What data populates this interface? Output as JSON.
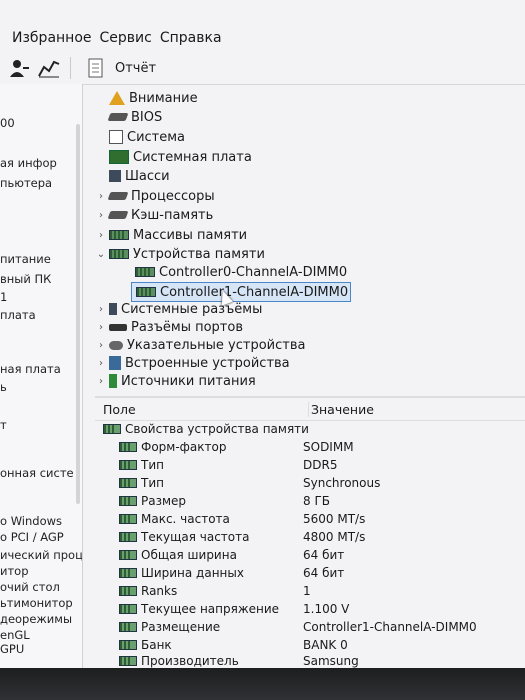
{
  "menu": [
    "Избранное",
    "Сервис",
    "Справка"
  ],
  "toolbar": {
    "report_label": "Отчёт"
  },
  "left_panel": [
    "00",
    "ая инфор",
    "пьютера",
    "питание",
    "вный ПК",
    "1",
    "плата",
    "ная плата",
    "ь",
    "т",
    "онная систе",
    "о Windows",
    "о PCI / AGP",
    "ический проц",
    "итор",
    "очий стол",
    "ьтимонитор",
    "деорежимы",
    "enGL",
    "GPU"
  ],
  "tree": [
    {
      "label": "Внимание",
      "icon": "warning-icon",
      "expand": ""
    },
    {
      "label": "BIOS",
      "icon": "chip-icon",
      "expand": ""
    },
    {
      "label": "Система",
      "icon": "computer-icon",
      "expand": ""
    },
    {
      "label": "Системная плата",
      "icon": "motherboard-icon",
      "expand": ""
    },
    {
      "label": "Шасси",
      "icon": "chassis-icon",
      "expand": ""
    },
    {
      "label": "Процессоры",
      "icon": "cpu-icon",
      "expand": "›"
    },
    {
      "label": "Кэш-память",
      "icon": "cache-icon",
      "expand": "›"
    },
    {
      "label": "Массивы памяти",
      "icon": "memory-icon",
      "expand": "›"
    },
    {
      "label": "Устройства памяти",
      "icon": "memory-icon",
      "expand": "⌄"
    },
    {
      "label": "Controller0-ChannelA-DIMM0",
      "icon": "memory-icon",
      "expand": "",
      "child": true
    },
    {
      "label": "Controller1-ChannelA-DIMM0",
      "icon": "memory-icon",
      "expand": "",
      "child": true,
      "selected": true
    },
    {
      "label": "Системные разъёмы",
      "icon": "slot-icon",
      "expand": "›"
    },
    {
      "label": "Разъёмы портов",
      "icon": "port-icon",
      "expand": "›"
    },
    {
      "label": "Указательные устройства",
      "icon": "mouse-icon",
      "expand": "›"
    },
    {
      "label": "Встроенные устройства",
      "icon": "device-icon",
      "expand": "›"
    },
    {
      "label": "Источники питания",
      "icon": "battery-icon",
      "expand": "›"
    }
  ],
  "details": {
    "col_field": "Поле",
    "col_value": "Значение",
    "section": "Свойства устройства памяти",
    "rows": [
      {
        "field": "Форм-фактор",
        "value": "SODIMM"
      },
      {
        "field": "Тип",
        "value": "DDR5"
      },
      {
        "field": "Тип",
        "value": "Synchronous"
      },
      {
        "field": "Размер",
        "value": "8 ГБ"
      },
      {
        "field": "Макс. частота",
        "value": "5600 MT/s"
      },
      {
        "field": "Текущая частота",
        "value": "4800 MT/s"
      },
      {
        "field": "Общая ширина",
        "value": "64 бит"
      },
      {
        "field": "Ширина данных",
        "value": "64 бит"
      },
      {
        "field": "Ranks",
        "value": "1"
      },
      {
        "field": "Текущее напряжение",
        "value": "1.100 V"
      },
      {
        "field": "Размещение",
        "value": "Controller1-ChannelA-DIMM0"
      },
      {
        "field": "Банк",
        "value": "BANK 0"
      },
      {
        "field": "Производитель",
        "value": "Samsung"
      }
    ]
  }
}
